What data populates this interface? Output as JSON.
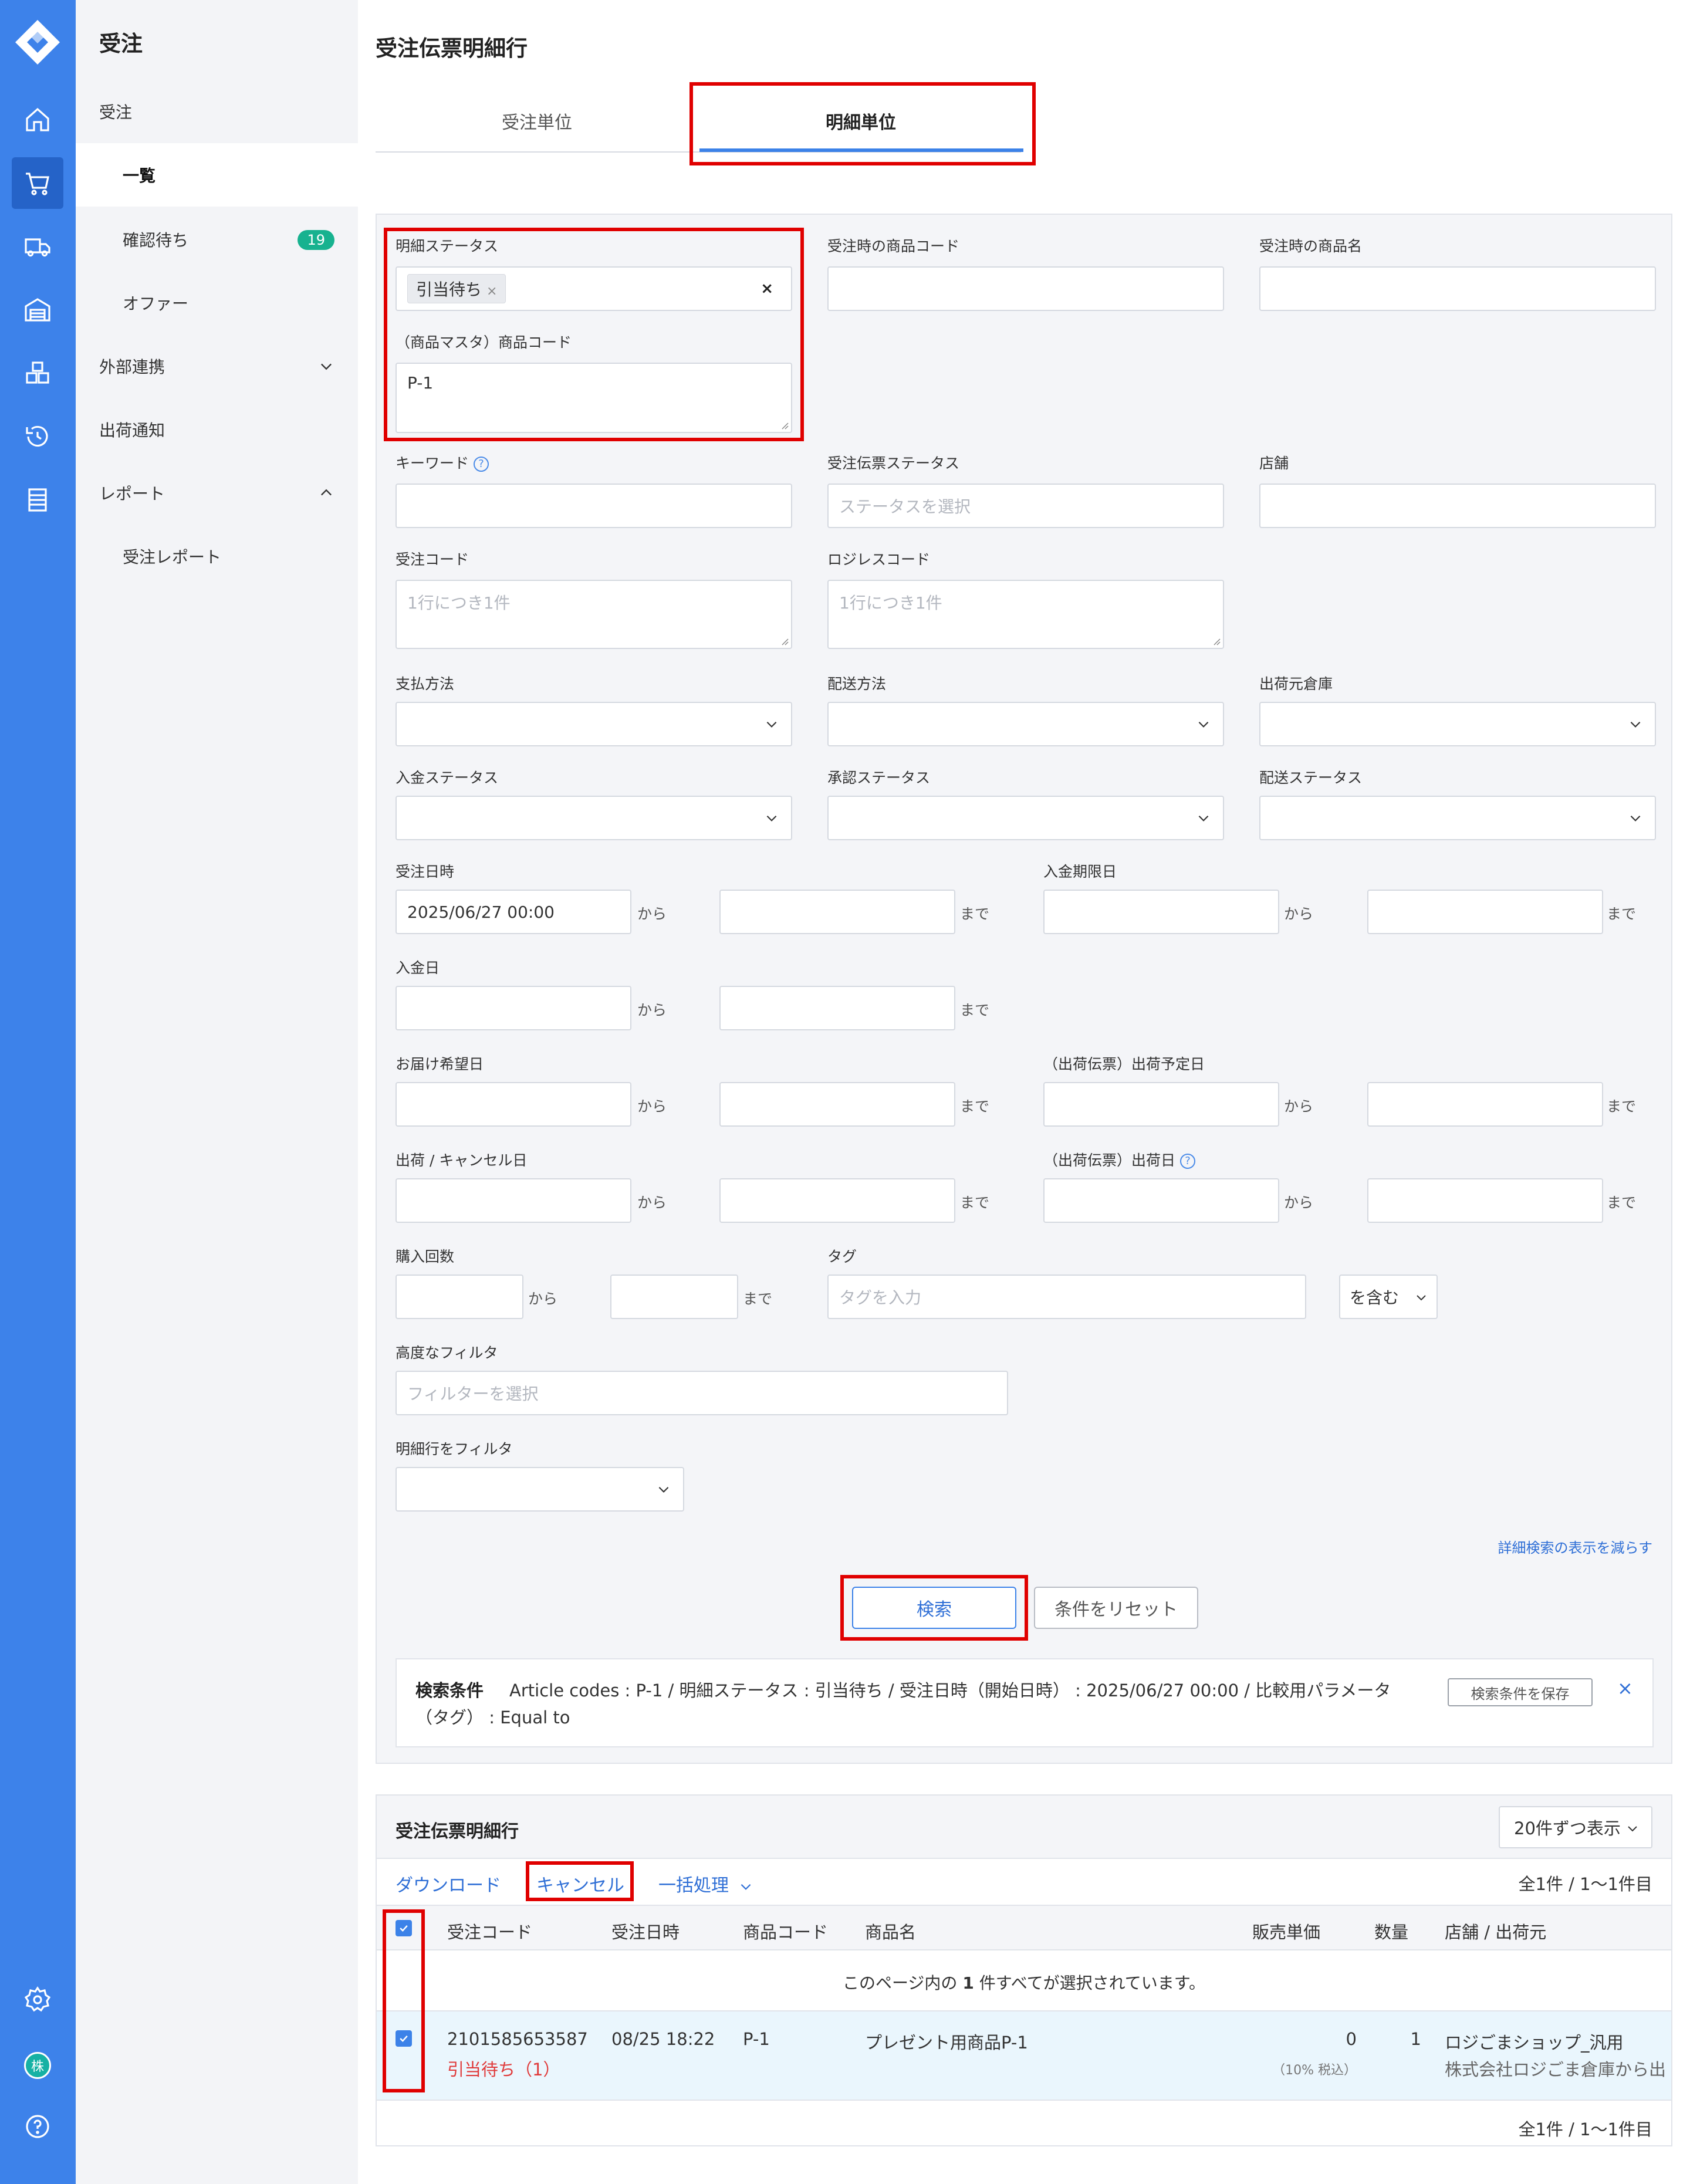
{
  "nav": {
    "title": "受注",
    "items": [
      {
        "label": "受注"
      },
      {
        "label": "一覧"
      },
      {
        "label": "確認待ち",
        "badge": "19"
      },
      {
        "label": "オファー"
      },
      {
        "label": "外部連携"
      },
      {
        "label": "出荷通知"
      },
      {
        "label": "レポート"
      },
      {
        "label": "受注レポート"
      }
    ],
    "avatar": "株"
  },
  "page": {
    "title": "受注伝票明細行",
    "tabs": [
      {
        "label": "受注単位",
        "active": false
      },
      {
        "label": "明細単位",
        "active": true
      }
    ]
  },
  "filters": {
    "detail_status": {
      "label": "明細ステータス",
      "chip": "引当待ち",
      "chip_remove": "×",
      "clear": "×"
    },
    "order_product_code": {
      "label": "受注時の商品コード",
      "value": ""
    },
    "order_product_name": {
      "label": "受注時の商品名",
      "value": ""
    },
    "master_product_code": {
      "label": "（商品マスタ）商品コード",
      "value": "P-1"
    },
    "keyword": {
      "label": "キーワード",
      "help": "?",
      "value": ""
    },
    "slip_status": {
      "label": "受注伝票ステータス",
      "placeholder": "ステータスを選択"
    },
    "store": {
      "label": "店舗",
      "value": ""
    },
    "order_code": {
      "label": "受注コード",
      "placeholder": "1行につき1件"
    },
    "logiless_code": {
      "label": "ロジレスコード",
      "placeholder": "1行につき1件"
    },
    "payment_method": {
      "label": "支払方法"
    },
    "delivery_method": {
      "label": "配送方法"
    },
    "ship_warehouse": {
      "label": "出荷元倉庫"
    },
    "payment_status": {
      "label": "入金ステータス"
    },
    "approval_status": {
      "label": "承認ステータス"
    },
    "delivery_status": {
      "label": "配送ステータス"
    },
    "order_datetime": {
      "label": "受注日時",
      "from": "2025/06/27 00:00",
      "to": ""
    },
    "payment_due": {
      "label": "入金期限日"
    },
    "payment_date": {
      "label": "入金日"
    },
    "desired_delivery": {
      "label": "お届け希望日"
    },
    "planned_ship": {
      "label": "（出荷伝票）出荷予定日"
    },
    "ship_cancel_date": {
      "label": "出荷 / キャンセル日"
    },
    "ship_date": {
      "label": "（出荷伝票）出荷日",
      "help": "?"
    },
    "purchase_count": {
      "label": "購入回数"
    },
    "tag": {
      "label": "タグ",
      "placeholder": "タグを入力",
      "mode": "を含む"
    },
    "advanced": {
      "label": "高度なフィルタ",
      "placeholder": "フィルターを選択"
    },
    "line_filter": {
      "label": "明細行をフィルタ"
    },
    "range_from": "から",
    "range_to": "まで"
  },
  "actions": {
    "collapse_link": "詳細検索の表示を減らす",
    "search": "検索",
    "reset": "条件をリセット"
  },
  "search_conditions": {
    "title": "検索条件",
    "text": "Article codes : P-1 / 明細ステータス : 引当待ち / 受注日時（開始日時） : 2025/06/27 00:00 / 比較用パラメータ（タグ） : Equal to",
    "save": "検索条件を保存",
    "close": "×"
  },
  "results": {
    "title": "受注伝票明細行",
    "per_page": "20件ずつ表示",
    "toolbar": {
      "download": "ダウンロード",
      "cancel": "キャンセル",
      "bulk": "一括処理"
    },
    "count_top": "全1件 / 1〜1件目",
    "count_bottom": "全1件 / 1〜1件目",
    "columns": [
      "受注コード",
      "受注日時",
      "商品コード",
      "商品名",
      "販売単価",
      "数量",
      "店舗 / 出荷元"
    ],
    "select_msg_pre": "このページ内の ",
    "select_msg_num": "1",
    "select_msg_post": " 件すべてが選択されています。",
    "rows": [
      {
        "order_code": "2101585653587",
        "status": "引当待ち（1）",
        "order_date": "08/25 18:22",
        "product_code": "P-1",
        "product_name": "プレゼント用商品P-1",
        "unit_price": "0",
        "tax_note": "（10% 税込）",
        "quantity": "1",
        "store": "ロジごまショップ_汎用",
        "origin": "株式会社ロジごま倉庫から出"
      }
    ]
  },
  "colors": {
    "rail": "#3d82ea",
    "accent": "#3c82e8",
    "highlight": "#e00000",
    "badge": "#17b28f",
    "row_selected": "#eaf6fd"
  }
}
